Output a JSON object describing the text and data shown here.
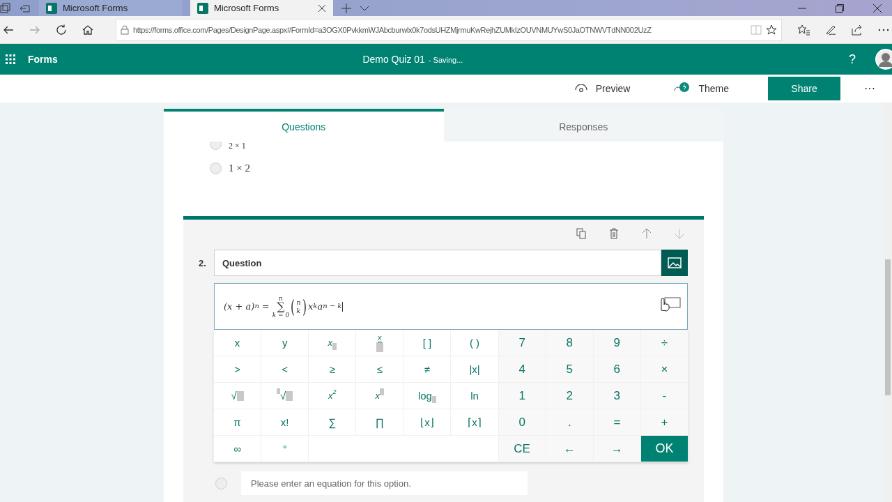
{
  "browser": {
    "tabs": [
      {
        "title": "Microsoft Forms",
        "selected": false
      },
      {
        "title": "Microsoft Forms",
        "selected": true
      }
    ],
    "url": "https://forms.office.com/Pages/DesignPage.aspx#FormId=a3OGX0PvkkmWJAbcburwlx0k7odsUHZMjrmuKwRejhZUMkIzOUVNMUYwS0JaOTNWVTdNN002UzZ"
  },
  "header": {
    "app": "Forms",
    "title": "Demo Quiz 01",
    "status": "- Saving...",
    "help": "?"
  },
  "toolbar": {
    "preview": "Preview",
    "theme": "Theme",
    "share": "Share",
    "more": "···"
  },
  "tabs": [
    {
      "label": "Questions",
      "selected": true
    },
    {
      "label": "Responses",
      "selected": false
    }
  ],
  "prev_options": [
    {
      "text": "2 × 1",
      "selected": false
    },
    {
      "text": "1 × 2",
      "selected": false
    }
  ],
  "question": {
    "number": "2.",
    "title": "Question",
    "equation": {
      "lhs": "(x + a)",
      "lhs_exp": "n",
      "equals": "=",
      "sum_top": "n",
      "sum_symbol": "∑",
      "sum_bottom": "k = 0",
      "binom_open": "(",
      "binom_top": "n",
      "binom_bottom": "k",
      "binom_close": ")",
      "base1": "x",
      "exp1": "k",
      "base2": "a",
      "exp2": "n − k"
    },
    "keys": [
      {
        "label": "x",
        "kind": "plain"
      },
      {
        "label": "y",
        "kind": "plain"
      },
      {
        "label": "x",
        "kind": "subscript"
      },
      {
        "label": "x",
        "kind": "fraction"
      },
      {
        "label": "[ ]",
        "kind": "plain"
      },
      {
        "label": "( )",
        "kind": "plain"
      },
      {
        "label": "7",
        "kind": "digit"
      },
      {
        "label": "8",
        "kind": "digit"
      },
      {
        "label": "9",
        "kind": "digit"
      },
      {
        "label": "÷",
        "kind": "digit"
      },
      {
        "label": ">",
        "kind": "plain"
      },
      {
        "label": "<",
        "kind": "plain"
      },
      {
        "label": "≥",
        "kind": "plain"
      },
      {
        "label": "≤",
        "kind": "plain"
      },
      {
        "label": "≠",
        "kind": "plain"
      },
      {
        "label": "|x|",
        "kind": "plain"
      },
      {
        "label": "4",
        "kind": "digit"
      },
      {
        "label": "5",
        "kind": "digit"
      },
      {
        "label": "6",
        "kind": "digit"
      },
      {
        "label": "×",
        "kind": "digit"
      },
      {
        "label": "√",
        "kind": "root"
      },
      {
        "label": "√",
        "kind": "nth-root"
      },
      {
        "label": "x",
        "exponent": "2",
        "kind": "square"
      },
      {
        "label": "x",
        "kind": "power"
      },
      {
        "label": "log",
        "kind": "subscript"
      },
      {
        "label": "ln",
        "kind": "plain"
      },
      {
        "label": "1",
        "kind": "digit"
      },
      {
        "label": "2",
        "kind": "digit"
      },
      {
        "label": "3",
        "kind": "digit"
      },
      {
        "label": "-",
        "kind": "digit"
      },
      {
        "label": "π",
        "kind": "plain"
      },
      {
        "label": "x!",
        "kind": "plain"
      },
      {
        "label": "∑",
        "kind": "plain"
      },
      {
        "label": "∏",
        "kind": "plain"
      },
      {
        "label": "⌊x⌋",
        "kind": "plain"
      },
      {
        "label": "⌈x⌉",
        "kind": "plain"
      },
      {
        "label": "0",
        "kind": "digit"
      },
      {
        "label": ".",
        "kind": "digit"
      },
      {
        "label": "=",
        "kind": "digit"
      },
      {
        "label": "+",
        "kind": "digit"
      },
      {
        "label": "∞",
        "kind": "plain"
      },
      {
        "label": "°",
        "kind": "plain"
      },
      {
        "label": "CE",
        "kind": "clear"
      },
      {
        "label": "←",
        "kind": "digit"
      },
      {
        "label": "→",
        "kind": "digit"
      },
      {
        "label": "OK",
        "kind": "confirm"
      }
    ],
    "option_selected": false,
    "option_placeholder": "Please enter an equation for this option."
  }
}
